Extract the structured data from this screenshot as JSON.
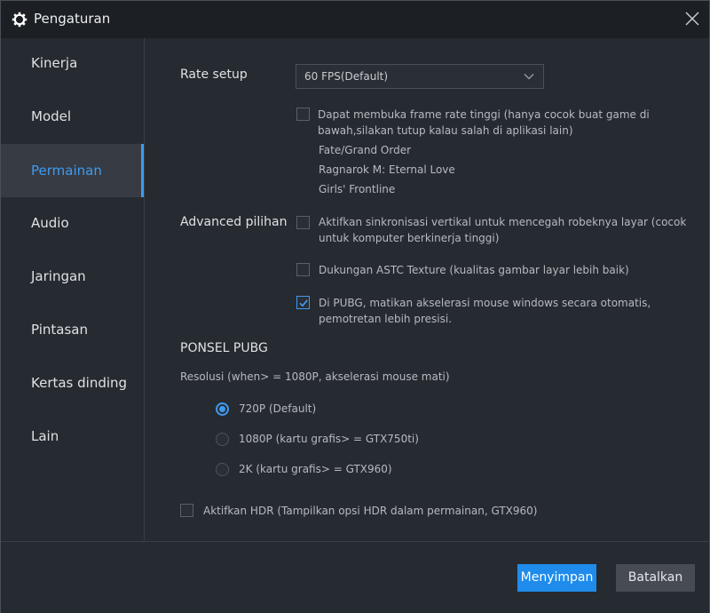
{
  "window": {
    "title": "Pengaturan"
  },
  "sidebar": {
    "items": [
      {
        "label": "Kinerja"
      },
      {
        "label": "Model"
      },
      {
        "label": "Permainan"
      },
      {
        "label": "Audio"
      },
      {
        "label": "Jaringan"
      },
      {
        "label": "Pintasan"
      },
      {
        "label": "Kertas dinding"
      },
      {
        "label": "Lain"
      }
    ],
    "active": "Permainan"
  },
  "rate": {
    "label": "Rate setup",
    "selected": "60  FPS(Default)",
    "high_fps": {
      "checked": false,
      "line1": "Dapat membuka frame rate tinggi  (hanya cocok buat game di",
      "line2": "bawah,silakan tutup kalau salah di aplikasi lain)"
    },
    "games": [
      "Fate/Grand Order",
      "Ragnarok M: Eternal Love",
      "Girls' Frontline"
    ]
  },
  "advanced": {
    "label": "Advanced pilihan",
    "vsync": {
      "checked": false,
      "line1": "Aktifkan sinkronisasi vertikal untuk mencegah robeknya layar   (cocok",
      "line2": "untuk komputer berkinerja tinggi)"
    },
    "astc": {
      "checked": false,
      "text": "Dukungan ASTC Texture   (kualitas gambar layar  lebih baik)"
    },
    "pubg_mouse": {
      "checked": true,
      "line1": "Di PUBG, matikan akselerasi mouse windows secara otomatis,",
      "line2": "pemotretan lebih presisi."
    }
  },
  "pubg": {
    "heading": "PONSEL PUBG",
    "resolution_label": "Resolusi   (when> = 1080P, akselerasi mouse mati)",
    "options": [
      {
        "label": "720P   (Default)",
        "selected": true
      },
      {
        "label": "1080P   (kartu grafis> = GTX750ti)",
        "selected": false
      },
      {
        "label": "2K   (kartu grafis> = GTX960)",
        "selected": false
      }
    ],
    "hdr": {
      "checked": false,
      "text": "Aktifkan HDR   (Tampilkan opsi HDR dalam permainan, GTX960)"
    }
  },
  "footer": {
    "save_label": "Menyimpan",
    "cancel_label": "Batalkan"
  },
  "colors": {
    "accent": "#3d9bf0",
    "save_button": "#1f8ceb",
    "background": "#262a31",
    "titlebar": "#1c1f24"
  }
}
